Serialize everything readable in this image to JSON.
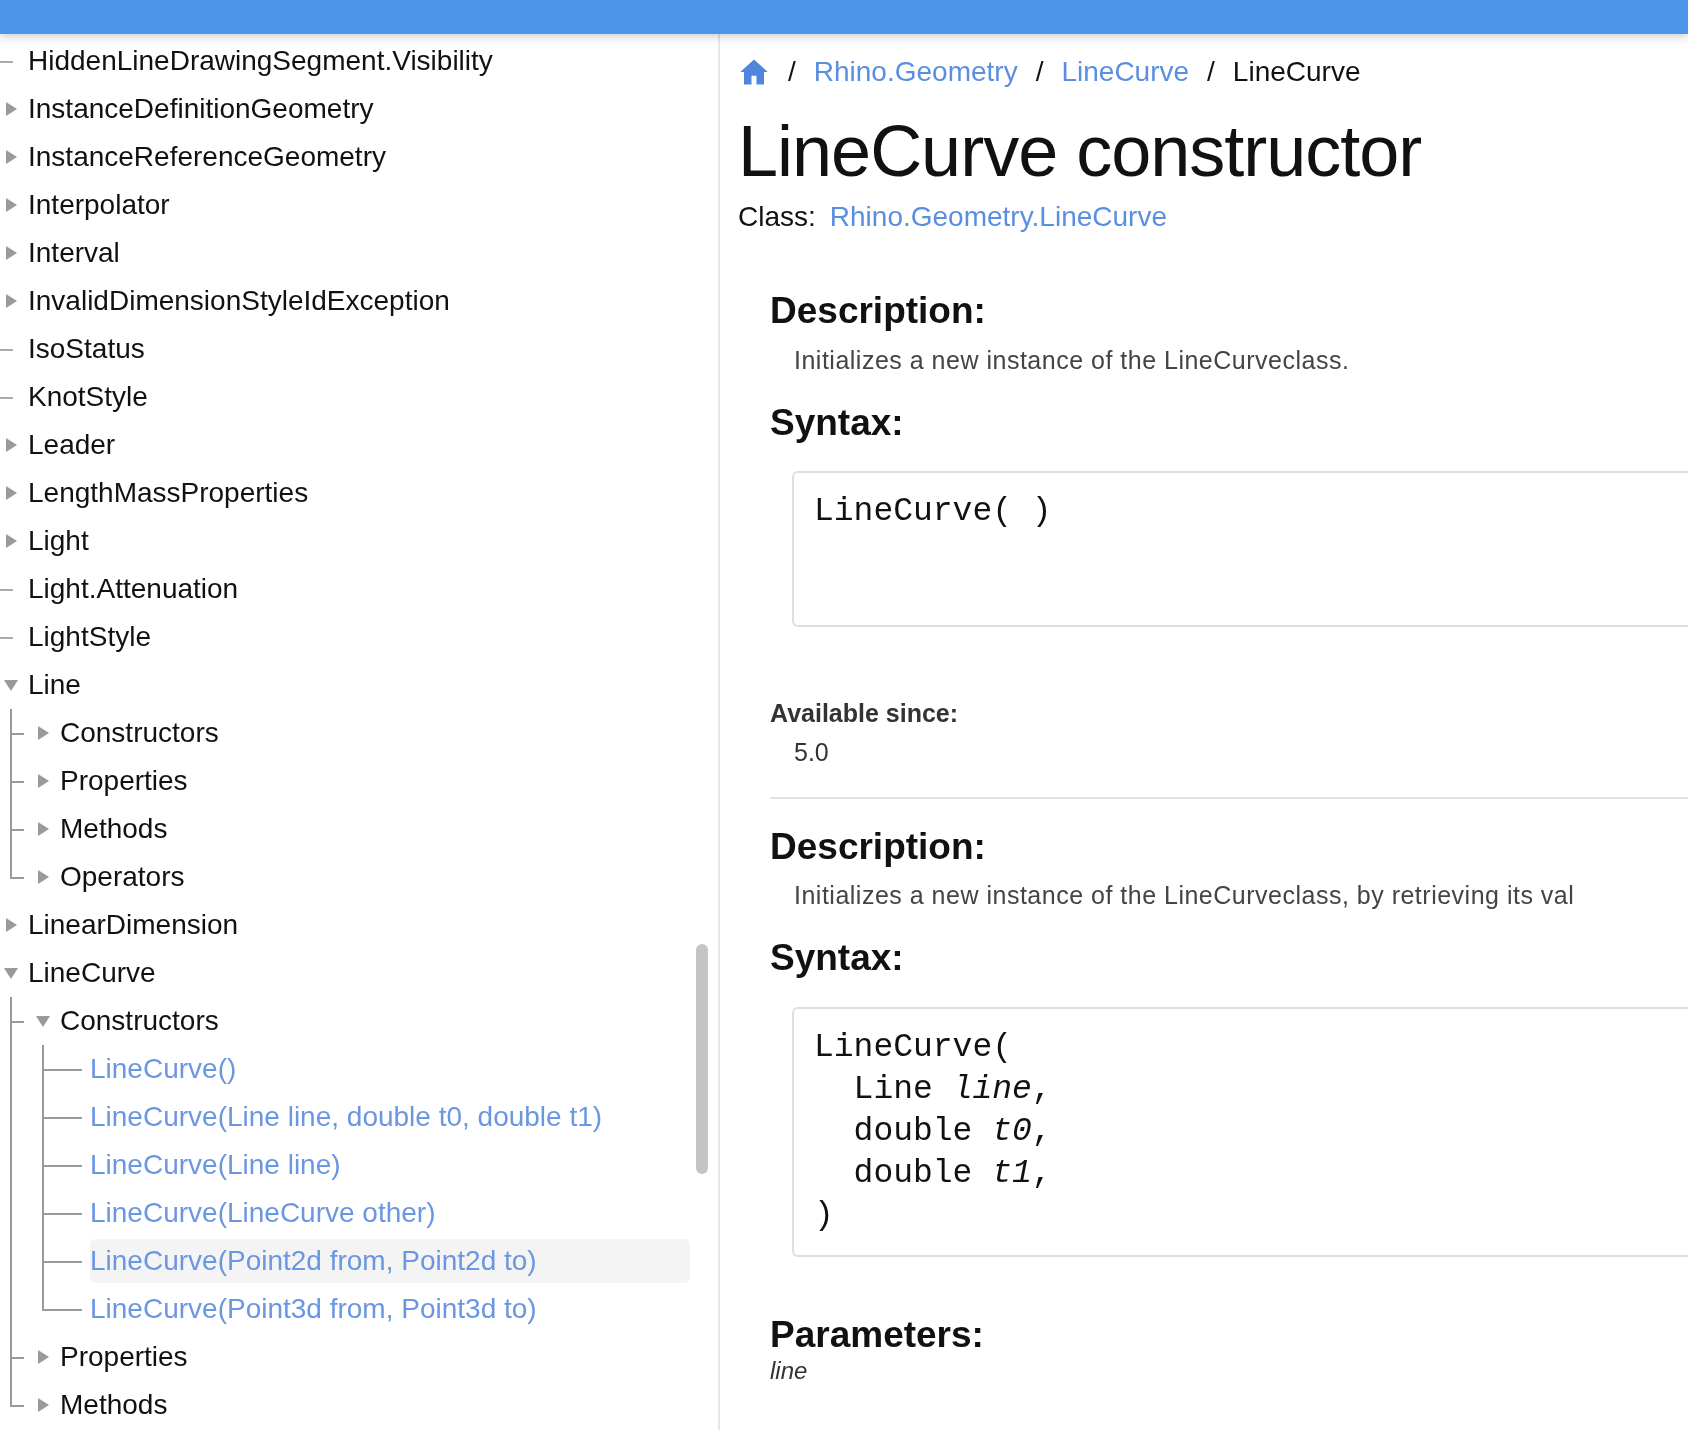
{
  "tree": [
    {
      "label": "HiddenLineDrawingSegment.Visibility",
      "kind": "leaf"
    },
    {
      "label": "InstanceDefinitionGeometry",
      "kind": "branch",
      "expanded": false
    },
    {
      "label": "InstanceReferenceGeometry",
      "kind": "branch",
      "expanded": false
    },
    {
      "label": "Interpolator",
      "kind": "branch",
      "expanded": false
    },
    {
      "label": "Interval",
      "kind": "branch",
      "expanded": false
    },
    {
      "label": "InvalidDimensionStyleIdException",
      "kind": "branch",
      "expanded": false
    },
    {
      "label": "IsoStatus",
      "kind": "leaf"
    },
    {
      "label": "KnotStyle",
      "kind": "leaf"
    },
    {
      "label": "Leader",
      "kind": "branch",
      "expanded": false
    },
    {
      "label": "LengthMassProperties",
      "kind": "branch",
      "expanded": false
    },
    {
      "label": "Light",
      "kind": "branch",
      "expanded": false
    },
    {
      "label": "Light.Attenuation",
      "kind": "leaf"
    },
    {
      "label": "LightStyle",
      "kind": "leaf"
    },
    {
      "label": "Line",
      "kind": "branch",
      "expanded": true,
      "children": [
        {
          "label": "Constructors",
          "kind": "branch",
          "expanded": false
        },
        {
          "label": "Properties",
          "kind": "branch",
          "expanded": false
        },
        {
          "label": "Methods",
          "kind": "branch",
          "expanded": false
        },
        {
          "label": "Operators",
          "kind": "branch",
          "expanded": false
        }
      ]
    },
    {
      "label": "LinearDimension",
      "kind": "branch",
      "expanded": false
    },
    {
      "label": "LineCurve",
      "kind": "branch",
      "expanded": true,
      "children": [
        {
          "label": "Constructors",
          "kind": "branch",
          "expanded": true,
          "children": [
            {
              "label": "LineCurve()",
              "kind": "link",
              "selected": false
            },
            {
              "label": "LineCurve(Line line, double t0, double t1)",
              "kind": "link",
              "selected": false
            },
            {
              "label": "LineCurve(Line line)",
              "kind": "link",
              "selected": false
            },
            {
              "label": "LineCurve(LineCurve other)",
              "kind": "link",
              "selected": false
            },
            {
              "label": "LineCurve(Point2d from, Point2d to)",
              "kind": "link",
              "selected": true
            },
            {
              "label": "LineCurve(Point3d from, Point3d to)",
              "kind": "link",
              "selected": false
            }
          ]
        },
        {
          "label": "Properties",
          "kind": "branch",
          "expanded": false
        },
        {
          "label": "Methods",
          "kind": "branch",
          "expanded": false
        }
      ]
    }
  ],
  "breadcrumb": {
    "links": [
      "Rhino.Geometry",
      "LineCurve"
    ],
    "separator": "/",
    "current": "LineCurve"
  },
  "title": "LineCurve constructor",
  "class_label": "Class:",
  "class_link": "Rhino.Geometry.LineCurve",
  "overloads": [
    {
      "description_heading": "Description:",
      "description": "Initializes a new instance of the LineCurveclass.",
      "syntax_heading": "Syntax:",
      "code": [
        "LineCurve( )"
      ],
      "available_heading": "Available since:",
      "available": "5.0"
    },
    {
      "description_heading": "Description:",
      "description": "Initializes a new instance of the LineCurveclass, by retrieving its val",
      "syntax_heading": "Syntax:",
      "code": [
        "LineCurve(",
        "  Line *line*,",
        "  double *t0*,",
        "  double *t1*,",
        ")"
      ],
      "parameters_heading": "Parameters:",
      "parameters": [
        "line"
      ]
    }
  ]
}
